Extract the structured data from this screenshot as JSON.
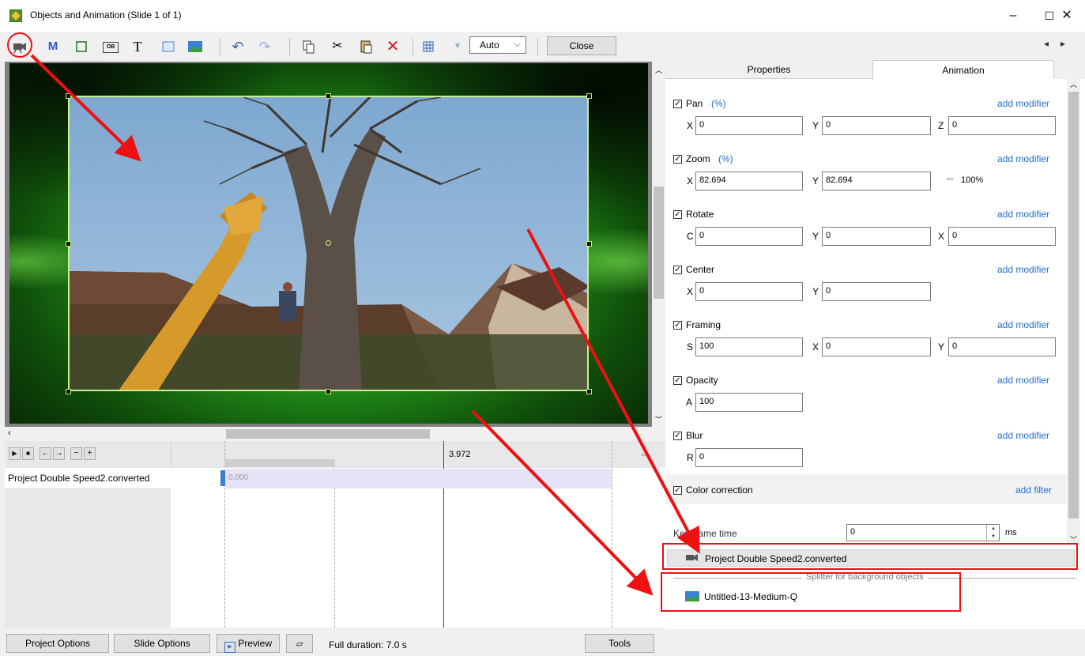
{
  "window": {
    "title": "Objects and Animation (Slide 1 of 1)",
    "minimize": "–",
    "maximize": "☐",
    "close": "✕"
  },
  "toolbar": {
    "text_tool": "T",
    "m_tool": "M",
    "ob_label": "OB",
    "auto_select": "Auto",
    "close_label": "Close",
    "nav_left": "◂",
    "nav_right": "▸"
  },
  "timeline": {
    "marker_time": "3.972",
    "track_name": "Project Double Speed2.converted",
    "track_start": "0.000"
  },
  "tabs": {
    "properties": "Properties",
    "animation": "Animation"
  },
  "animation": {
    "add_modifier": "add modifier",
    "add_filter": "add filter",
    "pan": {
      "label": "Pan",
      "unit": "(%)",
      "x": "0",
      "y": "0",
      "z": "0"
    },
    "zoom": {
      "label": "Zoom",
      "unit": "(%)",
      "x": "82.694",
      "y": "82.694",
      "percent": "100%"
    },
    "rotate": {
      "label": "Rotate",
      "c": "0",
      "y": "0",
      "x": "0"
    },
    "center": {
      "label": "Center",
      "x": "0",
      "y": "0"
    },
    "framing": {
      "label": "Framing",
      "s": "100",
      "x": "0",
      "y": "0"
    },
    "opacity": {
      "label": "Opacity",
      "a": "100"
    },
    "blur": {
      "label": "Blur",
      "r": "0"
    },
    "color_correction": {
      "label": "Color correction"
    },
    "key_frame_time": {
      "label": "Key frame time",
      "value": "0",
      "unit": "ms"
    },
    "axis": {
      "x": "X",
      "y": "Y",
      "z": "Z",
      "c": "C",
      "s": "S",
      "a": "A",
      "r": "R"
    }
  },
  "objects": {
    "video_object": "Project Double Speed2.converted",
    "splitter": "Splitter for background objects",
    "image_object": "Untitled-13-Medium-Q"
  },
  "bottom": {
    "project_options": "Project Options",
    "slide_options": "Slide Options",
    "preview": "Preview",
    "full_duration": "Full duration: 7.0 s",
    "tools": "Tools"
  },
  "colors": {
    "link": "#1e6fd0",
    "annotation_red": "#e11111",
    "frame_green": "#c8f08c"
  }
}
